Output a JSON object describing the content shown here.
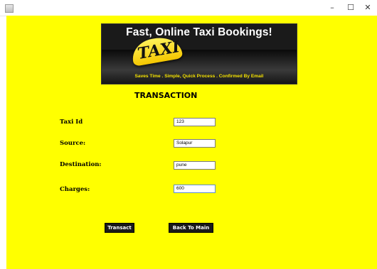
{
  "window": {
    "controls": {
      "minimize": "–",
      "maximize": "☐",
      "close": "✕"
    },
    "icon": "java-app-icon"
  },
  "banner": {
    "headline": "Fast, Online Taxi Bookings!",
    "sign_text": "TAXI",
    "tagline": "Saves Time . Simple, Quick Process . Confirmed By Email"
  },
  "form": {
    "heading": "TRANSACTION",
    "fields": [
      {
        "label": "Taxi Id",
        "value": "123"
      },
      {
        "label": "Source:",
        "value": "Solapur"
      },
      {
        "label": "Destination:",
        "value": "pune"
      },
      {
        "label": "Charges:",
        "value": "600"
      }
    ]
  },
  "buttons": {
    "transact": "Transact",
    "back": "Back To Main"
  },
  "colors": {
    "background": "#ffff00",
    "button_bg": "#1a1a1a",
    "button_text": "#ffffff"
  }
}
